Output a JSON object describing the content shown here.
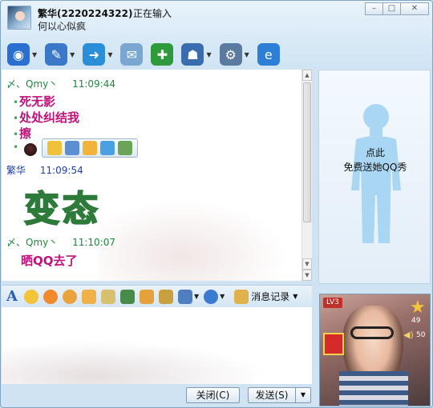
{
  "title": {
    "name": "繁华(2220224322)",
    "status": "正在输入",
    "signature": "何以心似疯"
  },
  "window_buttons": [
    "–",
    "□",
    "✕"
  ],
  "toolbar": {
    "items": [
      {
        "name": "webcam-icon",
        "glyph": "◉",
        "color": "#2a6fd0",
        "dropdown": true
      },
      {
        "name": "microphone-icon",
        "glyph": "✎",
        "color": "#3b78c8",
        "dropdown": true
      },
      {
        "name": "send-file-icon",
        "glyph": "➜",
        "color": "#2a8fd8",
        "dropdown": true
      },
      {
        "name": "email-icon",
        "glyph": "✉",
        "color": "#7aa6cf",
        "dropdown": false
      },
      {
        "name": "add-app-icon",
        "glyph": "✚",
        "color": "#2f9a3c",
        "dropdown": false
      },
      {
        "name": "group-icon",
        "glyph": "☗",
        "color": "#3a6db0",
        "dropdown": true
      },
      {
        "name": "settings-icon",
        "glyph": "⚙",
        "color": "#5a7aa0",
        "dropdown": true
      },
      {
        "name": "ie-icon",
        "glyph": "e",
        "color": "#2d7ed6",
        "dropdown": false
      }
    ]
  },
  "chat": {
    "messages": [
      {
        "sender": "〆、Qmy丶",
        "time": "11:09:44",
        "lines": [
          "死无影",
          "处处纠结我",
          "擦"
        ]
      },
      {
        "sender": "繁华",
        "time": "11:09:54",
        "sticker_text": "变态"
      },
      {
        "sender": "〆、Qmy丶",
        "time": "11:10:07",
        "lines": [
          "晒QQ去了"
        ]
      }
    ]
  },
  "format_toolbar": {
    "font_glyph": "A",
    "history_label": "消息记录"
  },
  "buttons": {
    "close": "关闭(C)",
    "send": "发送(S)"
  },
  "show": {
    "line1": "点此",
    "line2": "免费送她QQ秀"
  },
  "video": {
    "level": "LV3",
    "stars": "49",
    "volume": "50"
  }
}
